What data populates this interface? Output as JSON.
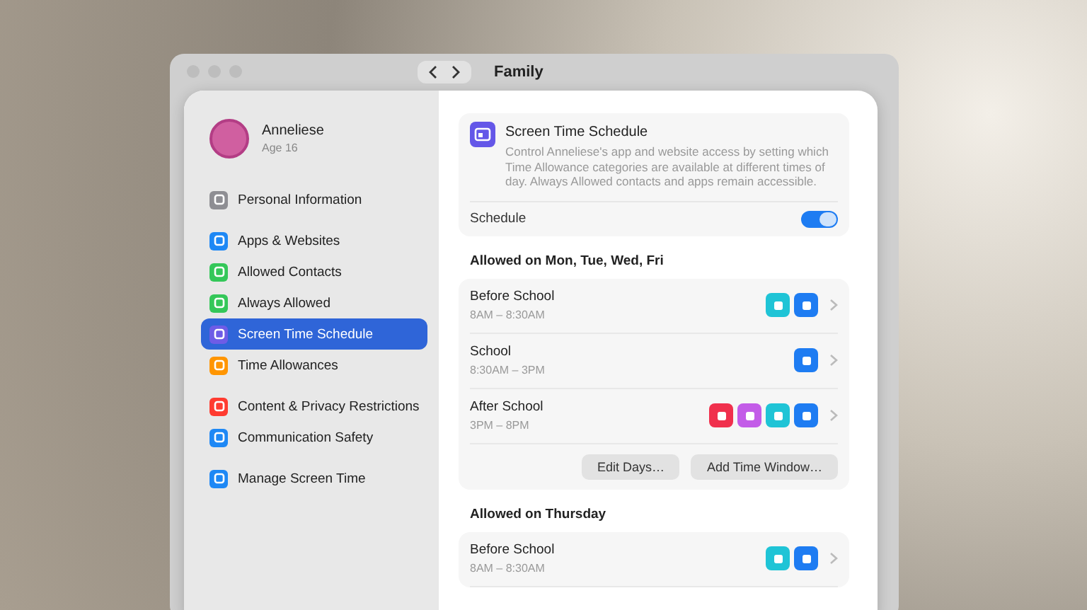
{
  "window": {
    "title": "Family"
  },
  "profile": {
    "name": "Anneliese",
    "age": "Age 16"
  },
  "sidebar": {
    "groups": [
      {
        "items": [
          {
            "label": "Personal Information",
            "color": "#8e8e93",
            "selected": false
          }
        ]
      },
      {
        "items": [
          {
            "label": "Apps & Websites",
            "color": "#1e88f5",
            "selected": false
          },
          {
            "label": "Allowed Contacts",
            "color": "#34c759",
            "selected": false
          },
          {
            "label": "Always Allowed",
            "color": "#34c759",
            "selected": false
          },
          {
            "label": "Screen Time Schedule",
            "color": "#6e5ce6",
            "selected": true
          },
          {
            "label": "Time Allowances",
            "color": "#ff9500",
            "selected": false
          }
        ]
      },
      {
        "items": [
          {
            "label": "Content & Privacy Restrictions",
            "color": "#ff3b30",
            "selected": false
          },
          {
            "label": "Communication Safety",
            "color": "#1e88f5",
            "selected": false
          }
        ]
      },
      {
        "items": [
          {
            "label": "Manage Screen Time",
            "color": "#1e88f5",
            "selected": false
          }
        ]
      }
    ]
  },
  "header": {
    "title": "Screen Time Schedule",
    "description": "Control Anneliese's app and website access by setting which Time Allowance categories are available at different times of day. Always Allowed contacts and apps remain accessible."
  },
  "schedule": {
    "label": "Schedule",
    "on": true
  },
  "sections": [
    {
      "title": "Allowed on Mon, Tue, Wed, Fri",
      "rows": [
        {
          "name": "Before School",
          "time": "8AM – 8:30AM",
          "apps": [
            {
              "color": "#1fc4d6"
            },
            {
              "color": "#1e7cf2"
            }
          ]
        },
        {
          "name": "School",
          "time": "8:30AM – 3PM",
          "apps": [
            {
              "color": "#1e7cf2"
            }
          ]
        },
        {
          "name": "After School",
          "time": "3PM – 8PM",
          "apps": [
            {
              "color": "#f0304d"
            },
            {
              "color": "#c35ce8"
            },
            {
              "color": "#1fc4d6"
            },
            {
              "color": "#1e7cf2"
            }
          ]
        }
      ],
      "buttons": [
        "Edit Days…",
        "Add Time Window…"
      ]
    },
    {
      "title": "Allowed on Thursday",
      "rows": [
        {
          "name": "Before School",
          "time": "8AM – 8:30AM",
          "apps": [
            {
              "color": "#1fc4d6"
            },
            {
              "color": "#1e7cf2"
            }
          ]
        }
      ]
    }
  ]
}
